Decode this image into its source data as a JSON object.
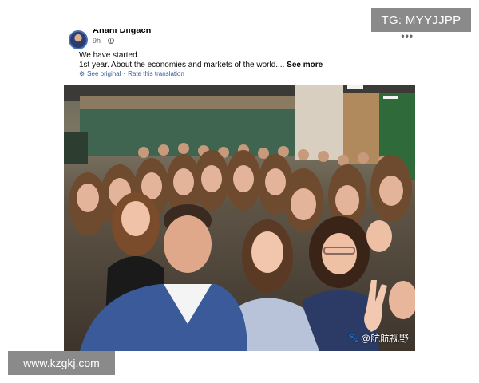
{
  "post": {
    "author": "Anahi Dilgach",
    "time": "9h ·",
    "line1": "We have started.",
    "line2": "1st year. About the economies and markets of the world....",
    "see_more": "See more",
    "see_original": "See original",
    "separator": "·",
    "rate_translation": "Rate this translation",
    "more_icon": "more-horizontal-icon",
    "privacy_icon": "globe-icon"
  },
  "watermarks": {
    "top_right": "TG: MYYJJPP",
    "bottom_left": "www.kzgkj.com",
    "photo_corner": "@航航视野"
  },
  "colors": {
    "watermark_bg": "#8a8a8a",
    "link": "#385898",
    "meta_text": "#65676b",
    "wall_green": "#2f6b3a"
  }
}
